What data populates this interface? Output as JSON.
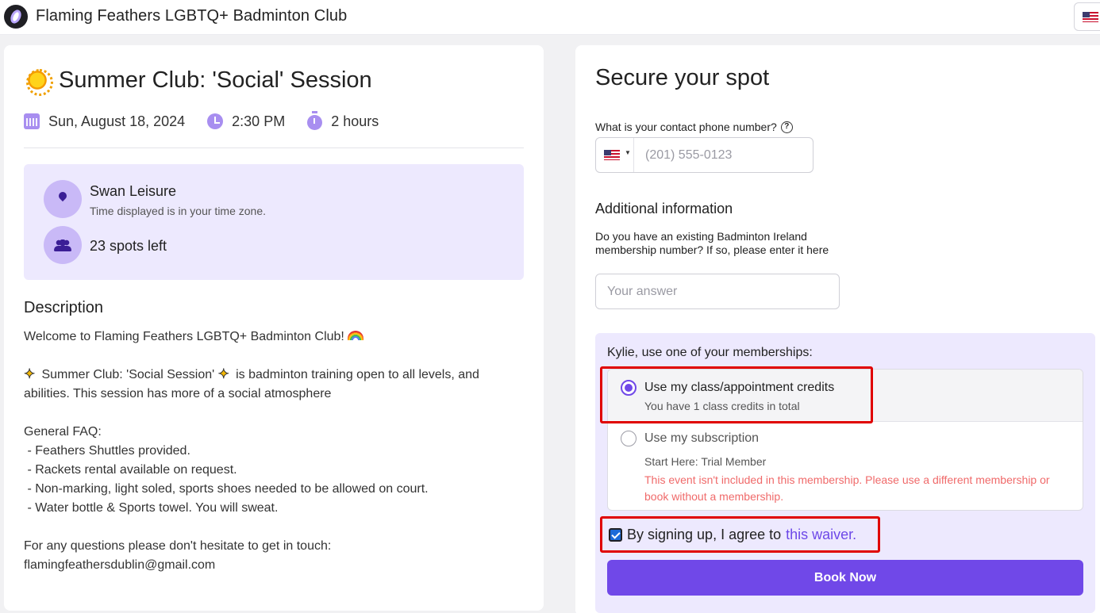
{
  "header": {
    "club_name": "Flaming Feathers LGBTQ+ Badminton Club",
    "language_flag": "us-flag-icon"
  },
  "event": {
    "title": "Summer Club: 'Social' Session",
    "title_icon": "sun-icon",
    "date": "Sun, August 18, 2024",
    "time": "2:30 PM",
    "duration": "2 hours",
    "venue": "Swan Leisure",
    "timezone_note": "Time displayed is in your time zone.",
    "spots_left": "23 spots left"
  },
  "description": {
    "heading": "Description",
    "welcome": "Welcome to Flaming Feathers LGBTQ+ Badminton Club!",
    "intro_a": " Summer Club: 'Social Session' ",
    "intro_b": " is badminton training open to all levels, and",
    "intro_c": "abilities. This session has more of a social atmosphere",
    "faq_heading": "General FAQ:",
    "faq": [
      " - Feathers Shuttles provided.",
      " - Rackets rental available on request.",
      " - Non-marking, light soled, sports shoes needed to be allowed on court.",
      " - Water bottle & Sports towel. You will sweat."
    ],
    "contact_line": "For any questions please don't hesitate to get in touch:",
    "email": "flamingfeathersdublin@gmail.com"
  },
  "booking": {
    "title": "Secure your spot",
    "phone_label": "What is your contact phone number?",
    "phone_value": "",
    "phone_placeholder": "(201) 555-0123",
    "additional_heading": "Additional information",
    "question": "Do you have an existing Badminton Ireland membership number? If so, please enter it here",
    "answer_value": "",
    "answer_placeholder": "Your answer",
    "membership_prompt": "Kylie, use one of your memberships:",
    "options": [
      {
        "label": "Use my class/appointment credits",
        "sub": "You have 1 class credits in total",
        "selected": true
      },
      {
        "label": "Use my subscription",
        "sub": "Start Here: Trial Member",
        "error": "This event isn't included in this membership. Please use a different membership or book without a membership.",
        "selected": false
      }
    ],
    "waiver_text": "By signing up, I agree to",
    "waiver_link": "this waiver.",
    "waiver_checked": true,
    "book_button": "Book Now"
  },
  "colors": {
    "accent": "#7048e8",
    "panel": "#ede9fe",
    "error": "#f06a6a",
    "highlight": "#e00000"
  }
}
